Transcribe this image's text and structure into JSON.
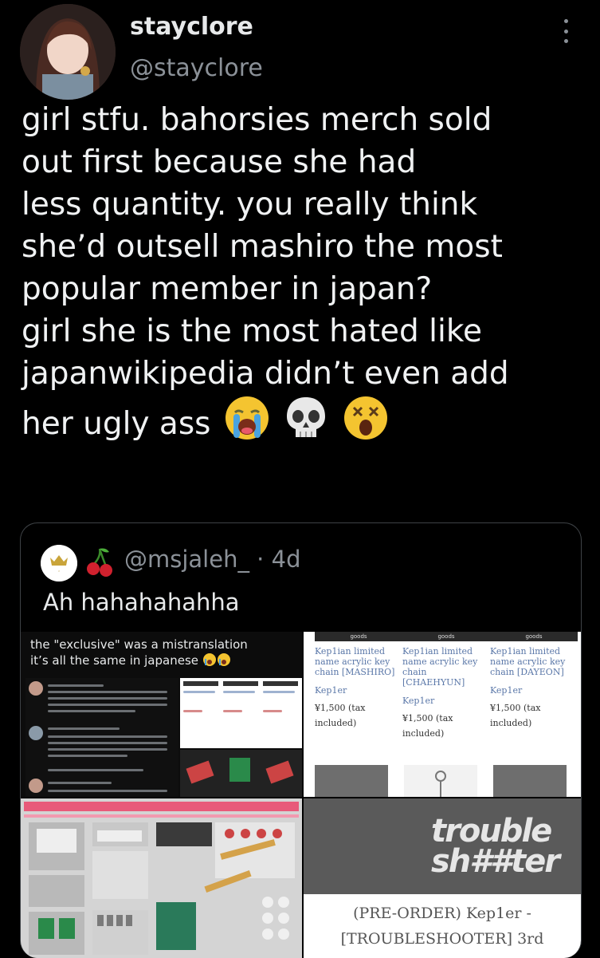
{
  "tweet": {
    "display_name": "stayclore",
    "handle": "@stayclore",
    "text_lines": [
      "girl stfu. bahorsies merch sold",
      "out first because she had",
      "less quantity. you really think",
      "she’d outsell mashiro the most",
      "popular member in japan?",
      "girl she is the most hated like",
      "japanwikipedia didn’t even add",
      "her ugly ass"
    ],
    "emojis": [
      "loudly-crying-face",
      "skull",
      "astonished-face"
    ]
  },
  "quote": {
    "handle_line": "@msjaleh_ · 4d",
    "emoji": "cherries",
    "text": "Ah hahahahahha",
    "images": {
      "screenshot": {
        "caption_line1": "the \"exclusive\" was a mistranslation",
        "caption_line2": "it’s all the same in japanese"
      },
      "shop": {
        "items": [
          {
            "goods": "goods",
            "name": "Kep1ian limited name acrylic key chain [MASHIRO]",
            "brand": "Kep1er",
            "price": "¥1,500 (tax included)"
          },
          {
            "goods": "goods",
            "name": "Kep1ian limited name acrylic key chain [CHAEHYUN]",
            "brand": "Kep1er",
            "price": "¥1,500 (tax included)"
          },
          {
            "goods": "goods",
            "name": "Kep1ian limited name acrylic key chain [DAYEON]",
            "brand": "Kep1er",
            "price": "¥1,500 (tax included)"
          }
        ]
      },
      "album": {
        "logo_line1": "trouble",
        "logo_line2": "sh##ter",
        "title_line1": "(PRE-ORDER) Kep1er -",
        "title_line2": "[TROUBLESHOOTER] 3rd"
      }
    }
  }
}
